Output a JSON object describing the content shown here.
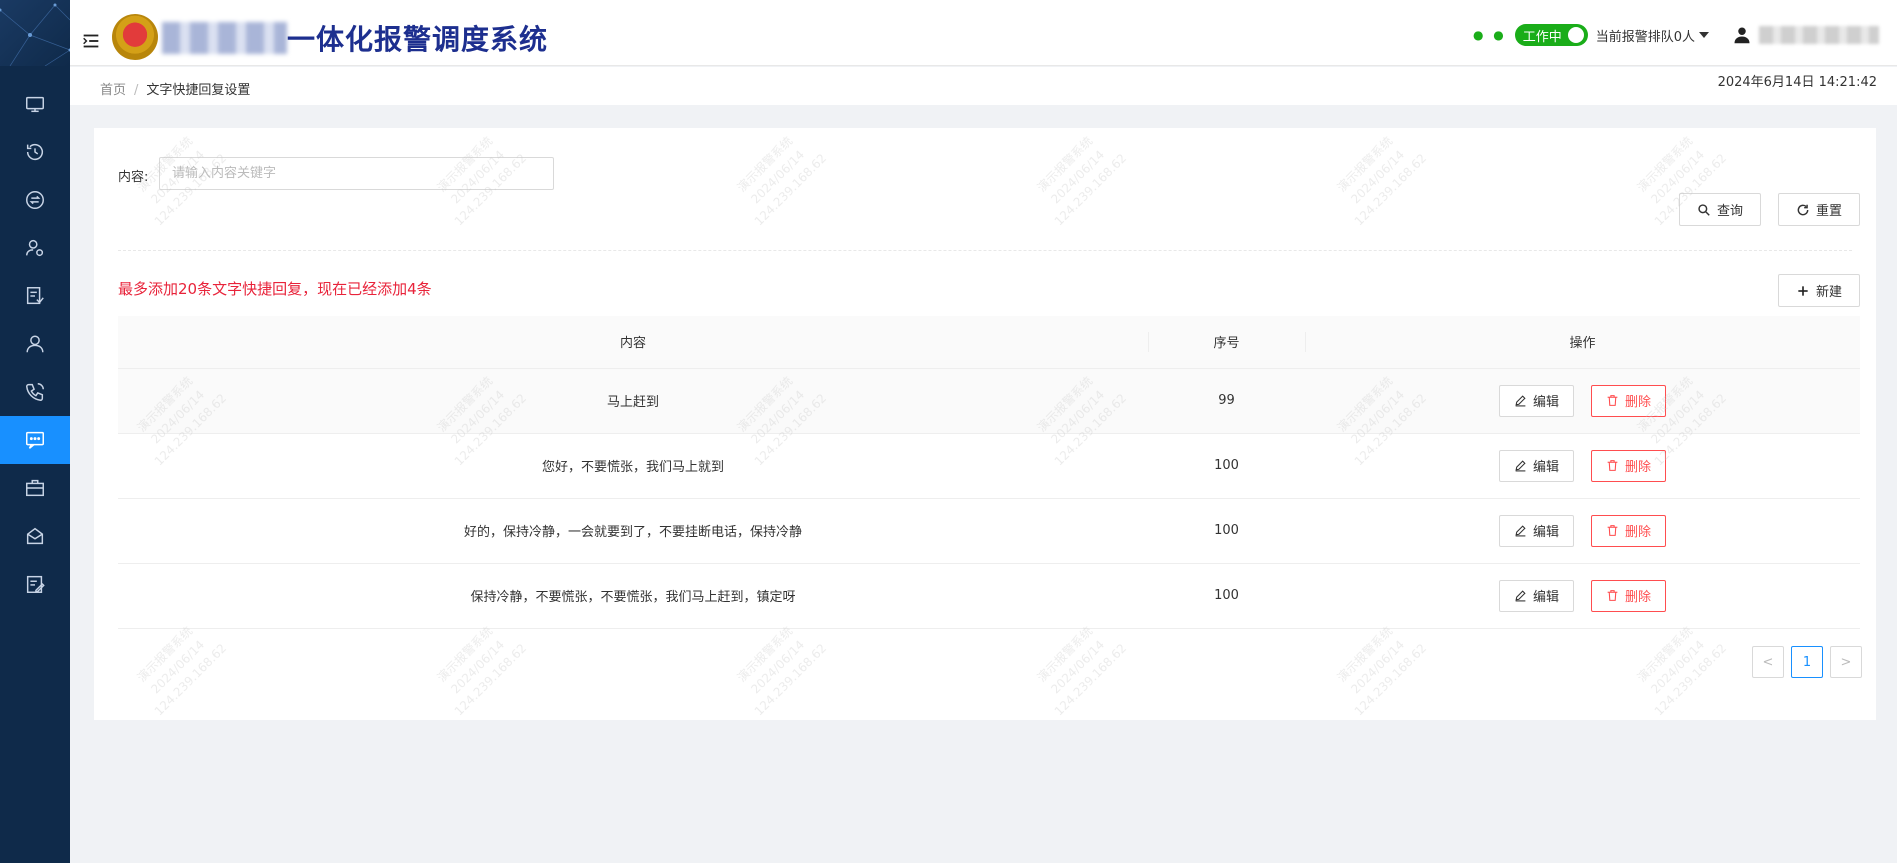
{
  "header": {
    "title": "一体化报警调度系统",
    "toggle_label": "工作中",
    "queue_label": "当前报警排队0人",
    "datetime": "2024年6月14日 14:21:42"
  },
  "breadcrumb": {
    "home": "首页",
    "separator": "/",
    "current": "文字快捷回复设置"
  },
  "search": {
    "label": "内容:",
    "placeholder": "请输入内容关键字",
    "query_label": "查询",
    "reset_label": "重置"
  },
  "notice": "最多添加20条文字快捷回复，现在已经添加4条",
  "new_label": "新建",
  "table": {
    "columns": [
      "内容",
      "序号",
      "操作"
    ],
    "edit_label": "编辑",
    "delete_label": "删除",
    "rows": [
      {
        "content": "马上赶到",
        "order": "99"
      },
      {
        "content": "您好，不要慌张，我们马上就到",
        "order": "100"
      },
      {
        "content": "好的，保持冷静，一会就要到了，不要挂断电话，保持冷静",
        "order": "100"
      },
      {
        "content": "保持冷静，不要慌张，不要慌张，我们马上赶到，镇定呀",
        "order": "100"
      }
    ]
  },
  "pagination": {
    "current_page": "1",
    "prev": "<",
    "next": ">"
  },
  "watermark": [
    "演示报警系统",
    "2024/06/14",
    "124.239.168.62"
  ],
  "colors": {
    "accent": "#1890ff",
    "danger": "#ff4d4f",
    "notice": "#e8233a",
    "sidebar": "#0f2a4a",
    "title": "#1d2f8f",
    "status_green": "#1aad19"
  },
  "icons": {
    "sidebar": [
      "monitor-icon",
      "history-icon",
      "transfer-icon",
      "user-settings-icon",
      "report-icon",
      "user-icon",
      "phone-icon",
      "message-icon",
      "briefcase-icon",
      "inbox-icon",
      "edit-note-icon"
    ]
  }
}
